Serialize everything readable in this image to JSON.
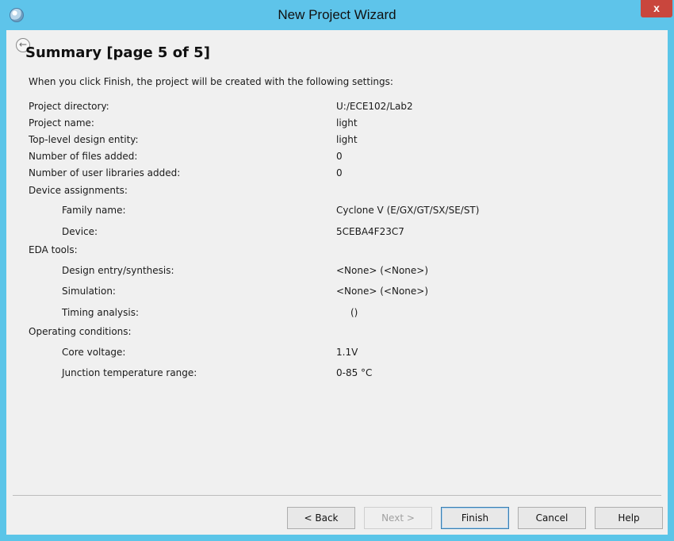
{
  "window": {
    "title": "New Project Wizard",
    "close_label": "x"
  },
  "page": {
    "title": "Summary [page 5 of 5]",
    "intro": "When you click Finish, the project will be created with the following settings:"
  },
  "settings": [
    {
      "label": "Project directory:",
      "value": "U:/ECE102/Lab2"
    },
    {
      "label": "Project name:",
      "value": "light"
    },
    {
      "label": "Top-level design entity:",
      "value": "light"
    },
    {
      "label": "Number of files added:",
      "value": "0"
    },
    {
      "label": "Number of user libraries added:",
      "value": "0"
    },
    {
      "label": "Device assignments:",
      "value": ""
    },
    {
      "label": "Family name:",
      "value": "Cyclone V (E/GX/GT/SX/SE/ST)"
    },
    {
      "label": "Device:",
      "value": "5CEBA4F23C7"
    },
    {
      "label": "EDA tools:",
      "value": ""
    },
    {
      "label": "Design entry/synthesis:",
      "value": "<None> (<None>)"
    },
    {
      "label": "Simulation:",
      "value": "<None> (<None>)"
    },
    {
      "label": "Timing analysis:",
      "value": "()"
    },
    {
      "label": "Operating conditions:",
      "value": ""
    },
    {
      "label": "Core voltage:",
      "value": "1.1V"
    },
    {
      "label": "Junction temperature range:",
      "value": "0-85 °C"
    }
  ],
  "buttons": {
    "back": "< Back",
    "next": "Next >",
    "finish": "Finish",
    "cancel": "Cancel",
    "help": "Help"
  },
  "colors": {
    "titlebar": "#5ec4ea",
    "close": "#c9463d",
    "client": "#f0f0f0"
  }
}
